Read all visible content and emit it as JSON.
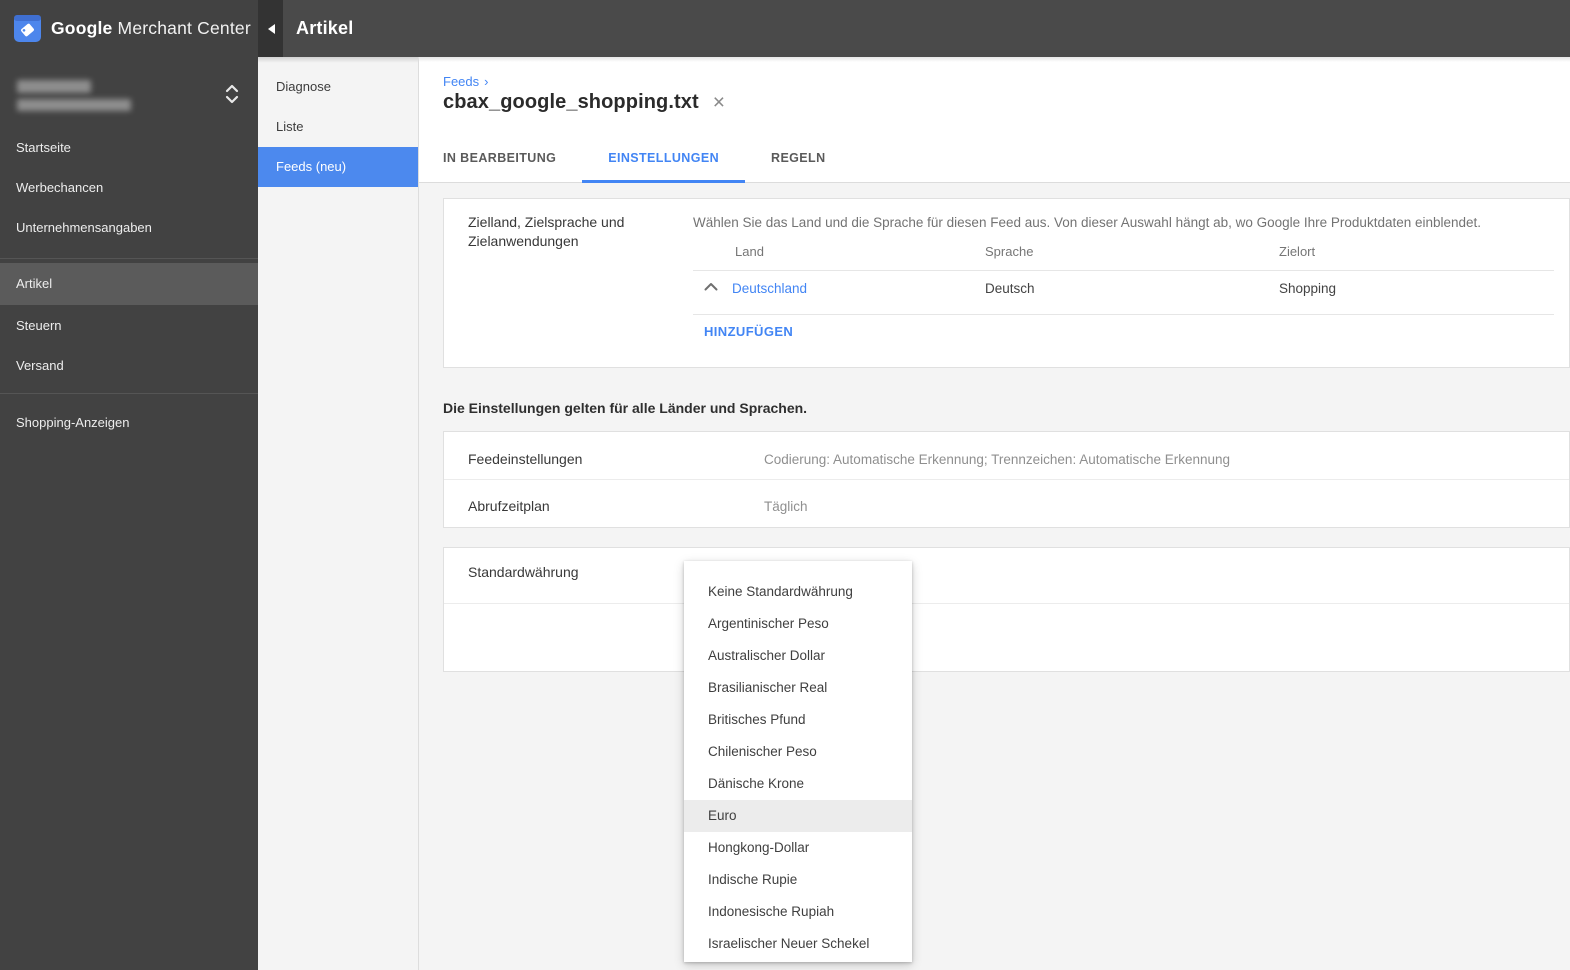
{
  "colors": {
    "accent_blue": "#4285f4",
    "subnav_selected_bg": "#4c89ee",
    "sidebar_bg": "#424242",
    "sidebar_selected_bg": "#5b5b5b",
    "topbar_bg": "#4a4a4a"
  },
  "logo": {
    "google": "Google",
    "product": "Merchant Center"
  },
  "topbar": {
    "title": "Artikel"
  },
  "sidebar": {
    "items": [
      {
        "label": "Startseite"
      },
      {
        "label": "Werbechancen"
      },
      {
        "label": "Unternehmensangaben"
      },
      {
        "label": "Artikel",
        "selected": true
      },
      {
        "label": "Steuern"
      },
      {
        "label": "Versand"
      },
      {
        "label": "Shopping-Anzeigen"
      }
    ]
  },
  "subnav": {
    "items": [
      {
        "label": "Diagnose"
      },
      {
        "label": "Liste"
      },
      {
        "label": "Feeds (neu)",
        "selected": true
      }
    ]
  },
  "breadcrumb": {
    "label": "Feeds",
    "separator": "›"
  },
  "page": {
    "title": "cbax_google_shopping.txt",
    "close": "×"
  },
  "tabs": {
    "items": [
      {
        "label": "IN BEARBEITUNG",
        "active": false
      },
      {
        "label": "EINSTELLUNGEN",
        "active": true
      },
      {
        "label": "REGELN",
        "active": false
      }
    ]
  },
  "target_section": {
    "label": "Zielland, Zielsprache und Zielanwendungen",
    "description": "Wählen Sie das Land und die Sprache für diesen Feed aus. Von dieser Auswahl hängt ab, wo Google Ihre Produktdaten einblendet.",
    "columns": {
      "land": "Land",
      "sprache": "Sprache",
      "zielort": "Zielort"
    },
    "row": {
      "land": "Deutschland",
      "sprache": "Deutsch",
      "zielort": "Shopping"
    },
    "add_label": "HINZUFÜGEN"
  },
  "note": "Die Einstellungen gelten für alle Länder und Sprachen.",
  "feed_settings": {
    "row1": {
      "label": "Feedeinstellungen",
      "value": "Codierung: Automatische Erkennung; Trennzeichen: Automatische Erkennung"
    },
    "row2": {
      "label": "Abrufzeitplan",
      "value": "Täglich"
    }
  },
  "currency": {
    "label": "Standardwährung",
    "dropdown": {
      "highlighted": "Euro",
      "items": [
        "Keine Standardwährung",
        "Argentinischer Peso",
        "Australischer Dollar",
        "Brasilianischer Real",
        "Britisches Pfund",
        "Chilenischer Peso",
        "Dänische Krone",
        "Euro",
        "Hongkong-Dollar",
        "Indische Rupie",
        "Indonesische Rupiah",
        "Israelischer Neuer Schekel"
      ]
    }
  }
}
